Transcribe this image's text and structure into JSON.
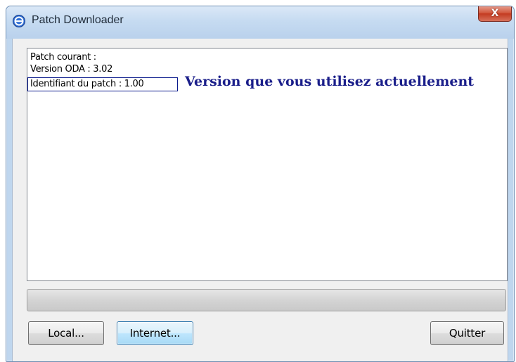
{
  "window": {
    "title": "Patch Downloader",
    "close_label": "X"
  },
  "log": {
    "lines": [
      "Patch courant :",
      "Version ODA : 3.02",
      "Identifiant du patch : 1.00"
    ],
    "annotation": "Version que vous utilisez actuellement"
  },
  "progress": {
    "value": 0
  },
  "buttons": {
    "local": "Local...",
    "internet": "Internet...",
    "quit": "Quitter"
  },
  "colors": {
    "annotation": "#1a1e8a",
    "close_button": "#c33a20"
  },
  "icons": {
    "app": "app-logo-icon",
    "close": "close-icon"
  }
}
